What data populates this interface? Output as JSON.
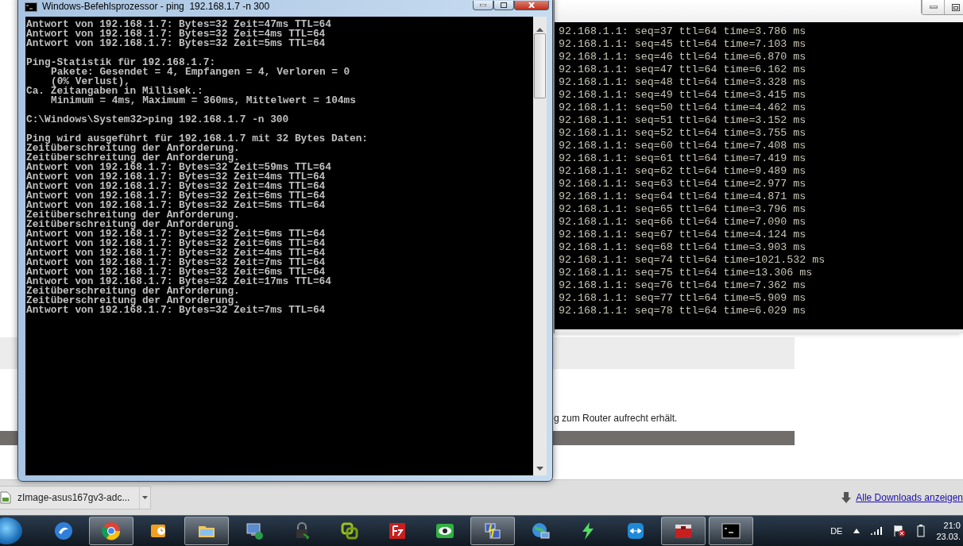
{
  "browser": {
    "paragraph": "g zum Router aufrecht erhält.",
    "download_bar": {
      "item": "zImage-asus167gv3-adc...",
      "link": "Alle Downloads anzeigen"
    }
  },
  "terminal": {
    "lines": [
      "92.168.1.1: seq=37 ttl=64 time=3.786 ms",
      "92.168.1.1: seq=45 ttl=64 time=7.103 ms",
      "92.168.1.1: seq=46 ttl=64 time=6.870 ms",
      "92.168.1.1: seq=47 ttl=64 time=6.162 ms",
      "92.168.1.1: seq=48 ttl=64 time=3.328 ms",
      "92.168.1.1: seq=49 ttl=64 time=3.415 ms",
      "92.168.1.1: seq=50 ttl=64 time=4.462 ms",
      "92.168.1.1: seq=51 ttl=64 time=3.152 ms",
      "92.168.1.1: seq=52 ttl=64 time=3.755 ms",
      "92.168.1.1: seq=60 ttl=64 time=7.408 ms",
      "92.168.1.1: seq=61 ttl=64 time=7.419 ms",
      "92.168.1.1: seq=62 ttl=64 time=9.489 ms",
      "92.168.1.1: seq=63 ttl=64 time=2.977 ms",
      "92.168.1.1: seq=64 ttl=64 time=4.871 ms",
      "92.168.1.1: seq=65 ttl=64 time=3.796 ms",
      "92.168.1.1: seq=66 ttl=64 time=7.090 ms",
      "92.168.1.1: seq=67 ttl=64 time=4.124 ms",
      "92.168.1.1: seq=68 ttl=64 time=3.903 ms",
      "92.168.1.1: seq=74 ttl=64 time=1021.532 ms",
      "92.168.1.1: seq=75 ttl=64 time=13.306 ms",
      "92.168.1.1: seq=76 ttl=64 time=7.362 ms",
      "92.168.1.1: seq=77 ttl=64 time=5.909 ms",
      "92.168.1.1: seq=78 ttl=64 time=6.029 ms"
    ]
  },
  "cmd": {
    "title": "Windows-Befehlsprozessor - ping  192.168.1.7 -n 300",
    "blocks": [
      [
        {
          "text": "Antwort von 192.168.1.7: Bytes=32 Zeit=47ms TTL=64",
          "indent": false
        },
        {
          "text": "Antwort von 192.168.1.7: Bytes=32 Zeit=4ms TTL=64",
          "indent": false
        },
        {
          "text": "Antwort von 192.168.1.7: Bytes=32 Zeit=5ms TTL=64",
          "indent": false
        }
      ],
      [
        {
          "text": "Ping-Statistik für 192.168.1.7:",
          "indent": false
        },
        {
          "text": "Pakete: Gesendet = 4, Empfangen = 4, Verloren = 0",
          "indent": true
        },
        {
          "text": "(0% Verlust),",
          "indent": true
        },
        {
          "text": "Ca. Zeitangaben in Millisek.:",
          "indent": false
        },
        {
          "text": "Minimum = 4ms, Maximum = 360ms, Mittelwert = 104ms",
          "indent": true
        }
      ],
      [
        {
          "text": "C:\\Windows\\System32>ping 192.168.1.7 -n 300",
          "indent": false
        }
      ],
      [
        {
          "text": "Ping wird ausgeführt für 192.168.1.7 mit 32 Bytes Daten:",
          "indent": false
        },
        {
          "text": "Zeitüberschreitung der Anforderung.",
          "indent": false
        },
        {
          "text": "Zeitüberschreitung der Anforderung.",
          "indent": false
        },
        {
          "text": "Antwort von 192.168.1.7: Bytes=32 Zeit=59ms TTL=64",
          "indent": false
        },
        {
          "text": "Antwort von 192.168.1.7: Bytes=32 Zeit=4ms TTL=64",
          "indent": false
        },
        {
          "text": "Antwort von 192.168.1.7: Bytes=32 Zeit=4ms TTL=64",
          "indent": false
        },
        {
          "text": "Antwort von 192.168.1.7: Bytes=32 Zeit=6ms TTL=64",
          "indent": false
        },
        {
          "text": "Antwort von 192.168.1.7: Bytes=32 Zeit=5ms TTL=64",
          "indent": false
        },
        {
          "text": "Zeitüberschreitung der Anforderung.",
          "indent": false
        },
        {
          "text": "Zeitüberschreitung der Anforderung.",
          "indent": false
        },
        {
          "text": "Antwort von 192.168.1.7: Bytes=32 Zeit=6ms TTL=64",
          "indent": false
        },
        {
          "text": "Antwort von 192.168.1.7: Bytes=32 Zeit=6ms TTL=64",
          "indent": false
        },
        {
          "text": "Antwort von 192.168.1.7: Bytes=32 Zeit=4ms TTL=64",
          "indent": false
        },
        {
          "text": "Antwort von 192.168.1.7: Bytes=32 Zeit=7ms TTL=64",
          "indent": false
        },
        {
          "text": "Antwort von 192.168.1.7: Bytes=32 Zeit=6ms TTL=64",
          "indent": false
        },
        {
          "text": "Antwort von 192.168.1.7: Bytes=32 Zeit=17ms TTL=64",
          "indent": false
        },
        {
          "text": "Zeitüberschreitung der Anforderung.",
          "indent": false
        },
        {
          "text": "Zeitüberschreitung der Anforderung.",
          "indent": false
        },
        {
          "text": "Antwort von 192.168.1.7: Bytes=32 Zeit=7ms TTL=64",
          "indent": false
        }
      ]
    ]
  },
  "taskbar": {
    "buttons": [
      {
        "running": false
      },
      {
        "running": true
      },
      {
        "running": false
      },
      {
        "running": true
      },
      {
        "running": false
      },
      {
        "running": false
      },
      {
        "running": false
      },
      {
        "running": false
      },
      {
        "running": false
      },
      {
        "running": true
      },
      {
        "running": false
      },
      {
        "running": false
      },
      {
        "running": false
      },
      {
        "running": true
      },
      {
        "running": true
      }
    ],
    "language": "DE",
    "time": "21:0",
    "date": "23.03."
  }
}
